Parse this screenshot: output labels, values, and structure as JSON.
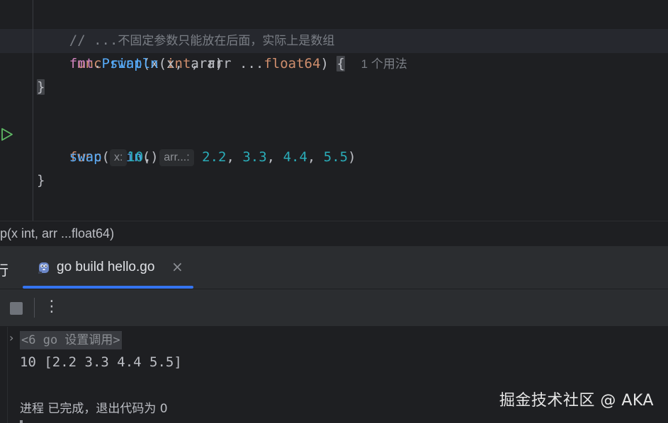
{
  "editor": {
    "comment": "// ...",
    "comment_cn": "不固定参数只能放在后面，实际上是数组",
    "line_swap": {
      "kw": "func",
      "name": "swap",
      "open": "(x ",
      "type_int": "int",
      "mid": ", arr ...",
      "type_float": "float64",
      "close": ") ",
      "brace": "{",
      "usages": "1 个用法"
    },
    "line_println": {
      "pkg": "fmt",
      "dot": ".",
      "method": "Println",
      "args": "(x, arr)"
    },
    "close_brace": "}",
    "line_main": {
      "kw": "func",
      "name": "main",
      "rest": "() {"
    },
    "line_call": {
      "name": "swap",
      "open": "(",
      "hint_x": "x:",
      "arg1": "10",
      "comma1": ", ",
      "hint_arr": "arr...:",
      "v1": "2.2",
      "v2": "3.3",
      "v3": "4.4",
      "v4": "5.5",
      "sep": ", ",
      "close": ")"
    },
    "main_close": "}"
  },
  "breadcrumb": "p(x int, arr ...float64)",
  "tool_window": {
    "title": "行",
    "tab_label": "go build hello.go",
    "tab_close": "×"
  },
  "toolbar": {
    "more": "⋮"
  },
  "console": {
    "fold_arrow": "›",
    "folded_cmd": "<6 go 设置调用>",
    "output": "10 [2.2 3.3 4.4 5.5]",
    "exit_label": "进程 已完成，退出代码为 0"
  },
  "watermark": "掘金技术社区 @ AKA",
  "colors": {
    "background": "#1e1f22",
    "keyword": "#cf8e6d",
    "function": "#56a8f5",
    "number": "#2aacb8",
    "accent": "#3574f0",
    "run": "#5fb865"
  },
  "icons": {
    "run_gutter": "run-triangle-icon",
    "tab": "go-gopher-icon",
    "stop": "stop-icon",
    "more": "more-vertical-icon"
  }
}
